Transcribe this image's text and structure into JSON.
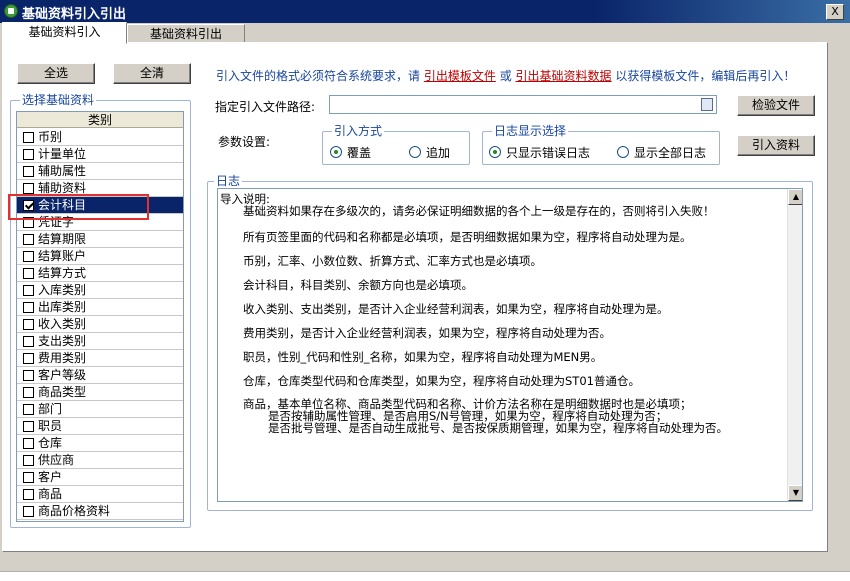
{
  "window": {
    "title": "基础资料引入引出",
    "close_label": "X"
  },
  "tabs": [
    {
      "label": "基础资料引入",
      "active": true
    },
    {
      "label": "基础资料引出",
      "active": false
    }
  ],
  "left": {
    "select_all": "全选",
    "clear_all": "全清",
    "group_title": "选择基础资料",
    "column_header": "类别",
    "items": [
      {
        "label": "币别",
        "checked": false
      },
      {
        "label": "计量单位",
        "checked": false
      },
      {
        "label": "辅助属性",
        "checked": false
      },
      {
        "label": "辅助资料",
        "checked": false
      },
      {
        "label": "会计科目",
        "checked": true,
        "selected": true
      },
      {
        "label": "凭证字",
        "checked": false
      },
      {
        "label": "结算期限",
        "checked": false
      },
      {
        "label": "结算账户",
        "checked": false
      },
      {
        "label": "结算方式",
        "checked": false
      },
      {
        "label": "入库类别",
        "checked": false
      },
      {
        "label": "出库类别",
        "checked": false
      },
      {
        "label": "收入类别",
        "checked": false
      },
      {
        "label": "支出类别",
        "checked": false
      },
      {
        "label": "费用类别",
        "checked": false
      },
      {
        "label": "客户等级",
        "checked": false
      },
      {
        "label": "商品类型",
        "checked": false
      },
      {
        "label": "部门",
        "checked": false
      },
      {
        "label": "职员",
        "checked": false
      },
      {
        "label": "仓库",
        "checked": false
      },
      {
        "label": "供应商",
        "checked": false
      },
      {
        "label": "客户",
        "checked": false
      },
      {
        "label": "商品",
        "checked": false
      },
      {
        "label": "商品价格资料",
        "checked": false
      }
    ]
  },
  "info": {
    "prefix": "引入文件的格式必须符合系统要求，请",
    "link1": "引出模板文件",
    "mid": "或",
    "link2": "引出基础资料数据",
    "suffix": "以获得模板文件，编辑后再引入！"
  },
  "path": {
    "label": "指定引入文件路径:",
    "value": "",
    "browse_icon": "folder-icon",
    "check_button": "检验文件"
  },
  "params": {
    "label": "参数设置:",
    "import_mode": {
      "title": "引入方式",
      "options": [
        "覆盖",
        "追加"
      ],
      "selected": "覆盖"
    },
    "log_mode": {
      "title": "日志显示选择",
      "options": [
        "只显示错误日志",
        "显示全部日志"
      ],
      "selected": "只显示错误日志"
    },
    "import_button": "引入资料"
  },
  "log": {
    "title": "日志",
    "heading": "导入说明:",
    "lines": [
      "基础资料如果存在多级次的，请务必保证明细数据的各个上一级是存在的，否则将引入失败！",
      "所有页签里面的代码和名称都是必填项，是否明细数据如果为空，程序将自动处理为是。",
      "币别，汇率、小数位数、折算方式、汇率方式也是必填项。",
      "会计科目，科目类别、余额方向也是必填项。",
      "收入类别、支出类别，是否计入企业经营利润表，如果为空，程序将自动处理为是。",
      "费用类别，是否计入企业经营利润表，如果为空，程序将自动处理为否。",
      "职员，性别_代码和性别_名称，如果为空，程序将自动处理为MEN男。",
      "仓库，仓库类型代码和仓库类型，如果为空，程序将自动处理为ST01普通仓。"
    ],
    "goods_lines": [
      "商品，基本单位名称、商品类型代码和名称、计价方法名称在是明细数据时也是必填项；",
      "是否按辅助属性管理、是否启用S/N号管理，如果为空，程序将自动处理为否；",
      "是否批号管理、是否自动生成批号、是否按保质期管理，如果为空，程序将自动处理为否。"
    ]
  }
}
